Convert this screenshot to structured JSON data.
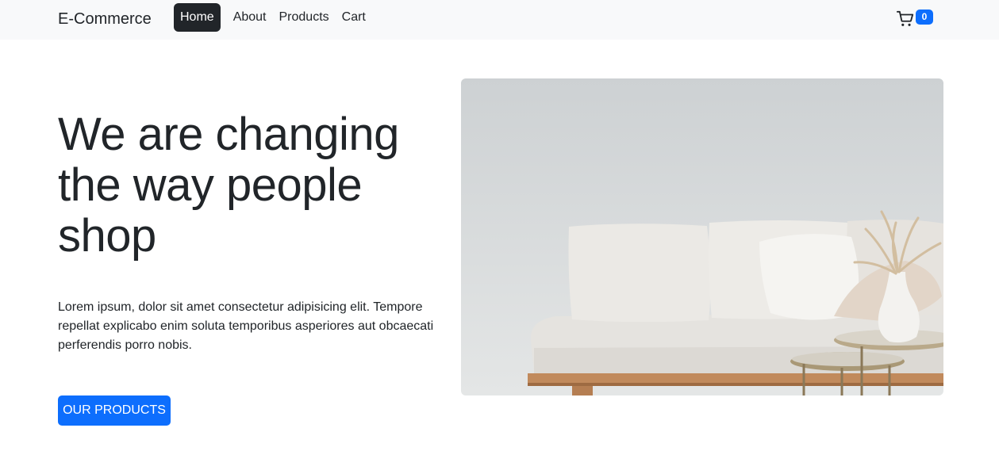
{
  "navbar": {
    "brand": "E-Commerce",
    "links": [
      {
        "label": "Home",
        "active": true
      },
      {
        "label": "About",
        "active": false
      },
      {
        "label": "Products",
        "active": false
      },
      {
        "label": "Cart",
        "active": false
      }
    ],
    "cart": {
      "icon": "cart-icon",
      "count": "0"
    }
  },
  "hero": {
    "title": "We are changing the way people shop",
    "text": "Lorem ipsum, dolor sit amet consectetur adipisicing elit. Tempore repellat explicabo enim soluta temporibus asperiores aut obcaecati perferendis porro nobis.",
    "button_label": "OUR PRODUCTS",
    "image": "sofa-living-room-photo"
  },
  "colors": {
    "primary": "#0d6efd",
    "dark": "#212529",
    "navbar_bg": "#f8f9fa"
  }
}
